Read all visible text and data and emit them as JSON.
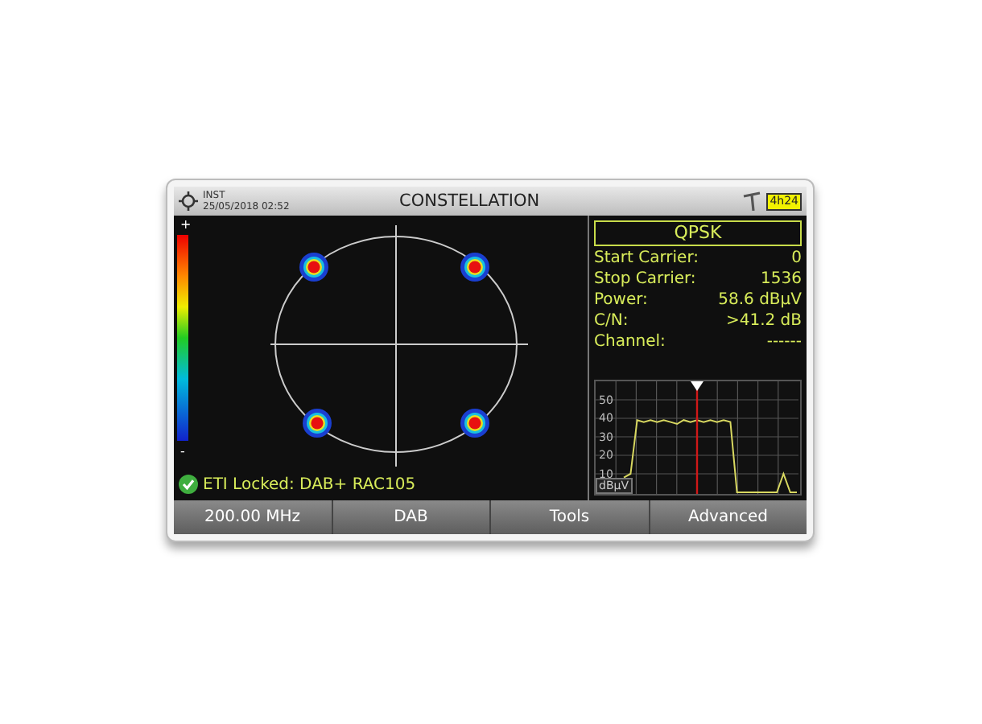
{
  "header": {
    "mode": "INST",
    "datetime": "25/05/2018 02:52",
    "title": "CONSTELLATION",
    "battery": "4h24"
  },
  "constellation": {
    "scale_max": "+",
    "scale_min": "-",
    "status": "ETI Locked: DAB+ RAC105"
  },
  "info": {
    "modulation": "QPSK",
    "rows": [
      {
        "label": "Start Carrier:",
        "value": "0"
      },
      {
        "label": "Stop Carrier:",
        "value": "1536"
      },
      {
        "label": "Power:",
        "value": "58.6 dBµV"
      },
      {
        "label": "C/N:",
        "value": ">41.2 dB"
      },
      {
        "label": "Channel:",
        "value": "------"
      }
    ]
  },
  "spectrum": {
    "unit": "dBµV",
    "chart_data": {
      "type": "line",
      "grid": true,
      "ylim": [
        0,
        60
      ],
      "yticks": [
        50,
        40,
        30,
        20,
        10
      ],
      "series": [
        {
          "color": "#d8d860",
          "values": [
            null,
            null,
            null,
            null,
            8,
            10,
            39,
            38,
            39,
            38,
            39,
            38,
            37,
            39,
            38,
            39,
            38,
            39,
            38,
            39,
            38,
            0,
            0,
            0,
            0,
            0,
            0,
            0,
            10,
            0,
            0
          ]
        }
      ]
    }
  },
  "buttons": [
    "200.00 MHz",
    "DAB",
    "Tools",
    "Advanced"
  ]
}
